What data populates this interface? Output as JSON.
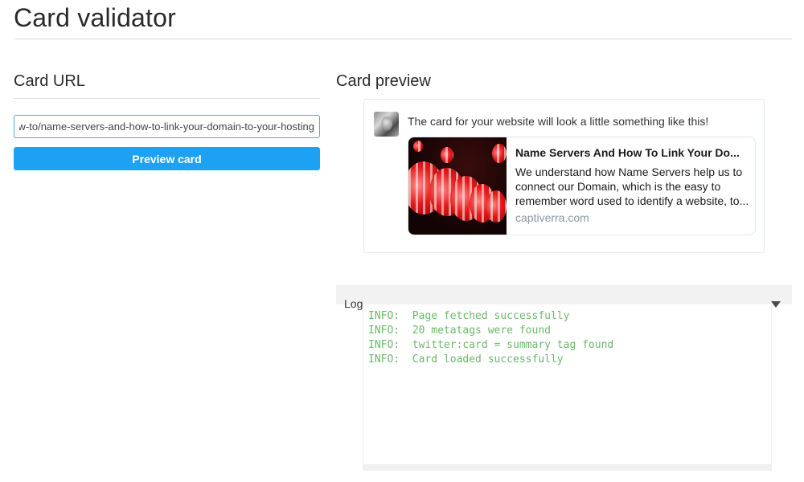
{
  "page": {
    "title": "Card validator"
  },
  "url_section": {
    "heading": "Card URL",
    "url_value": "https://captiverra.com/how-to/name-servers-and-how-to-link-your-domain-to-your-hosting/",
    "button_label": "Preview card"
  },
  "preview_section": {
    "heading": "Card preview",
    "intro_text": "The card for your website will look a little something like this!",
    "card": {
      "title": "Name Servers And How To Link Your Do...",
      "description": "We understand how Name Servers help us to connect our Domain, which is the easy to remember word used to identify a website, to...",
      "domain": "captiverra.com",
      "image_icon": "red-paper-lanterns-image"
    }
  },
  "log": {
    "label": "Log",
    "toggle_icon": "caret-down-icon",
    "lines": [
      "INFO:  Page fetched successfully",
      "INFO:  20 metatags were found",
      "INFO:  twitter:card = summary tag found",
      "INFO:  Card loaded successfully"
    ]
  },
  "colors": {
    "accent": "#1da1f2",
    "log_text": "#6ab86a",
    "domain_text": "#8899a6"
  }
}
